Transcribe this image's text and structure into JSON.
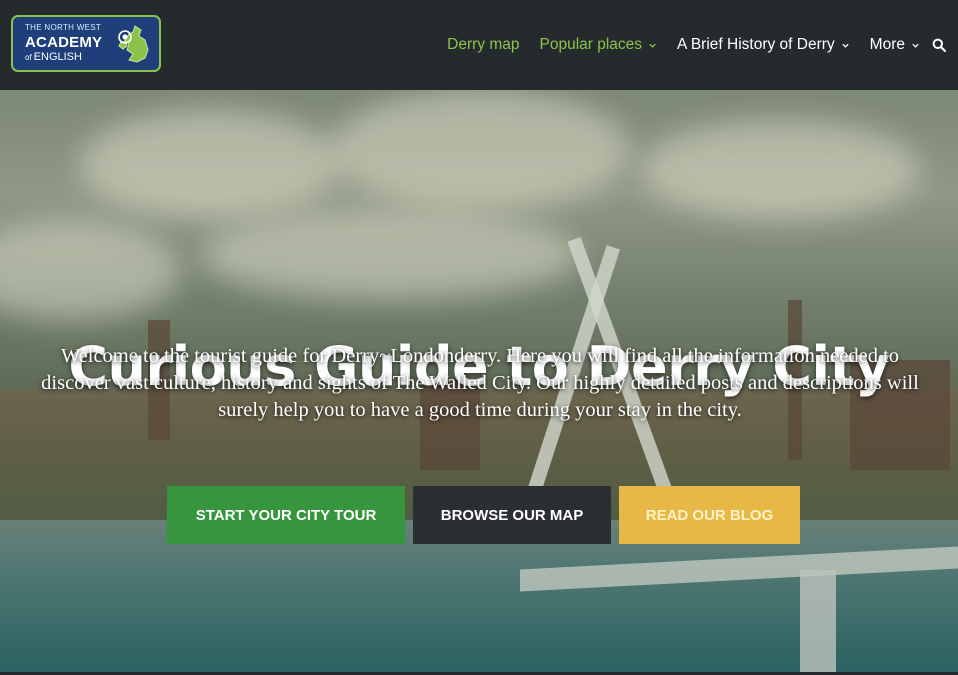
{
  "logo": {
    "line1": "THE NORTH WEST",
    "line2": "ACADEMY",
    "line3_of": "of",
    "line3": "ENGLISH"
  },
  "nav": {
    "items": [
      {
        "label": "Derry map",
        "has_dropdown": false,
        "color": "#8bc34a"
      },
      {
        "label": "Popular places",
        "has_dropdown": true,
        "color": "#8bc34a"
      },
      {
        "label": "A Brief History of Derry",
        "has_dropdown": true,
        "color": "#ffffff"
      },
      {
        "label": "More",
        "has_dropdown": true,
        "color": "#ffffff"
      }
    ],
    "search_icon": "search-icon"
  },
  "hero": {
    "title": "Curious Guide to Derry City",
    "subtitle": "Welcome to the tourist guide for Derry~Londonderry. Here you will find all the information needed to discover vast culture, history and sights of The Walled City. Our highly detailed posts and descriptions will surely help you to have a good time during your stay in the city.",
    "buttons": [
      {
        "label": "START YOUR CITY TOUR",
        "color": "#37963d"
      },
      {
        "label": "BROWSE OUR MAP",
        "color": "#2b2f33"
      },
      {
        "label": "READ OUR BLOG",
        "color": "#e8b846"
      }
    ]
  }
}
